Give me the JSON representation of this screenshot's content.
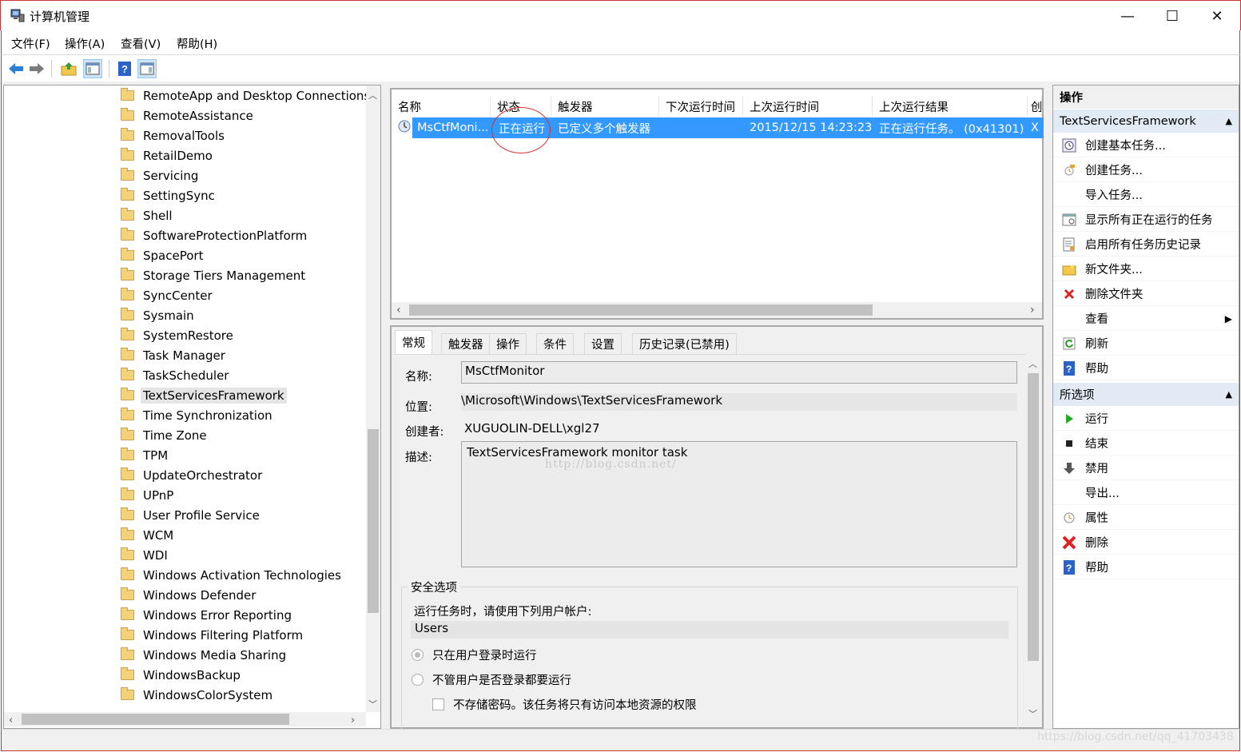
{
  "window": {
    "title": "计算机管理",
    "minimize": "—",
    "maximize": "☐",
    "close": "✕"
  },
  "menu": [
    "文件(F)",
    "操作(A)",
    "查看(V)",
    "帮助(H)"
  ],
  "tree": {
    "items": [
      "RemoteApp and Desktop Connections",
      "RemoteAssistance",
      "RemovalTools",
      "RetailDemo",
      "Servicing",
      "SettingSync",
      "Shell",
      "SoftwareProtectionPlatform",
      "SpacePort",
      "Storage Tiers Management",
      "SyncCenter",
      "Sysmain",
      "SystemRestore",
      "Task Manager",
      "TaskScheduler",
      "TextServicesFramework",
      "Time Synchronization",
      "Time Zone",
      "TPM",
      "UpdateOrchestrator",
      "UPnP",
      "User Profile Service",
      "WCM",
      "WDI",
      "Windows Activation Technologies",
      "Windows Defender",
      "Windows Error Reporting",
      "Windows Filtering Platform",
      "Windows Media Sharing",
      "WindowsBackup",
      "WindowsColorSystem"
    ],
    "selected": "TextServicesFramework"
  },
  "tasklist": {
    "columns": [
      "名称",
      "状态",
      "触发器",
      "下次运行时间",
      "上次运行时间",
      "上次运行结果",
      "创"
    ],
    "row": {
      "name": "MsCtfMoni...",
      "status": "正在运行",
      "trigger": "已定义多个触发器",
      "next_run": "",
      "last_run": "2015/12/15 14:23:23",
      "last_result": "正在运行任务。 (0x41301)",
      "author": "X"
    }
  },
  "details": {
    "tabs": [
      "常规",
      "触发器",
      "操作",
      "条件",
      "设置",
      "历史记录(已禁用)"
    ],
    "name_label": "名称:",
    "name_value": "MsCtfMonitor",
    "location_label": "位置:",
    "location_value": "\\Microsoft\\Windows\\TextServicesFramework",
    "author_label": "创建者:",
    "author_value": "XUGUOLIN-DELL\\xgl27",
    "desc_label": "描述:",
    "desc_value": "TextServicesFramework monitor task",
    "security": {
      "title": "安全选项",
      "account_prompt": "运行任务时，请使用下列用户帐户:",
      "account": "Users",
      "opt_logged_on": "只在用户登录时运行",
      "opt_always": "不管用户是否登录都要运行",
      "no_store_password": "不存储密码。该任务将只有访问本地资源的权限"
    }
  },
  "actions": {
    "header": "操作",
    "group1": {
      "title": "TextServicesFramework",
      "items": [
        {
          "label": "创建基本任务...",
          "icon": "basic-task-icon"
        },
        {
          "label": "创建任务...",
          "icon": "create-task-icon"
        },
        {
          "label": "导入任务...",
          "icon": ""
        },
        {
          "label": "显示所有正在运行的任务",
          "icon": "running-tasks-icon"
        },
        {
          "label": "启用所有任务历史记录",
          "icon": "history-icon"
        },
        {
          "label": "新文件夹...",
          "icon": "new-folder-icon"
        },
        {
          "label": "删除文件夹",
          "icon": "delete-folder-icon"
        },
        {
          "label": "查看",
          "icon": ""
        },
        {
          "label": "刷新",
          "icon": "refresh-icon"
        },
        {
          "label": "帮助",
          "icon": "help-icon"
        }
      ]
    },
    "group2": {
      "title": "所选项",
      "items": [
        {
          "label": "运行",
          "icon": "run-icon"
        },
        {
          "label": "结束",
          "icon": "end-icon"
        },
        {
          "label": "禁用",
          "icon": "disable-icon"
        },
        {
          "label": "导出...",
          "icon": ""
        },
        {
          "label": "属性",
          "icon": "properties-icon"
        },
        {
          "label": "删除",
          "icon": "delete-icon"
        },
        {
          "label": "帮助",
          "icon": "help-icon"
        }
      ]
    }
  },
  "watermarks": {
    "center": "http://blog.csdn.net/",
    "bottom": "https://blog.csdn.net/qq_41703438"
  },
  "colors": {
    "selection": "#3399ff",
    "annotation": "#d63030",
    "group_header": "#e2ebf5"
  }
}
